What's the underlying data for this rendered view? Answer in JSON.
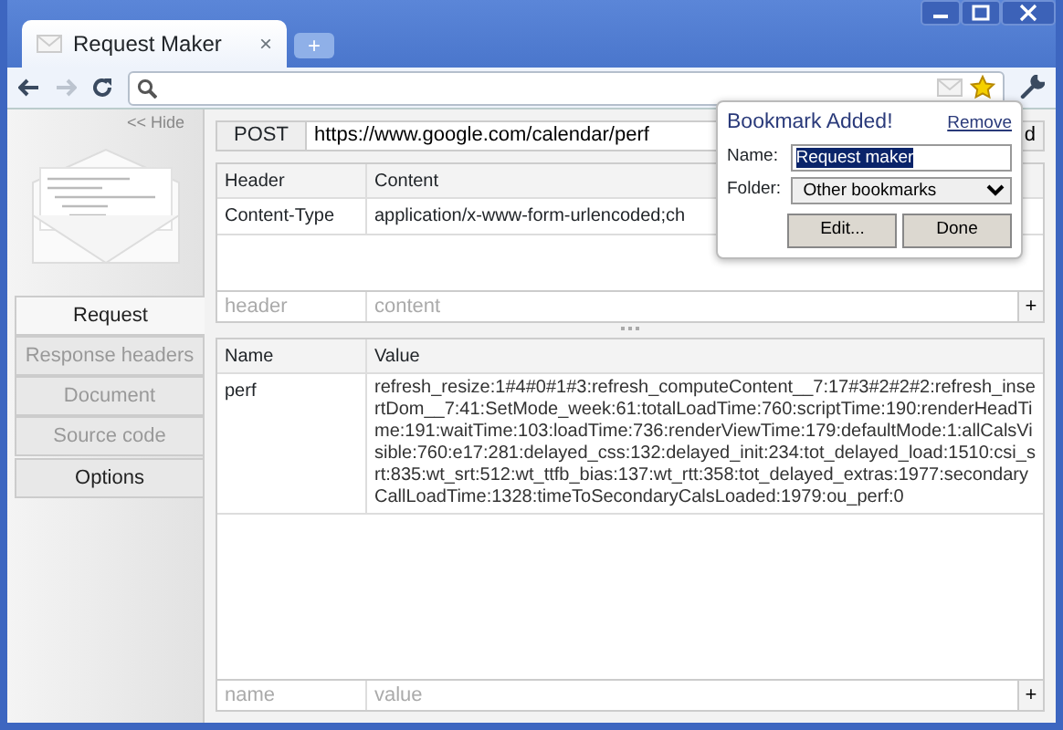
{
  "browser": {
    "tab_title": "Request Maker",
    "close": "×",
    "new_tab": "+"
  },
  "sidebar": {
    "hide_link": "<< Hide",
    "tabs": [
      {
        "label": "Request",
        "selected": true,
        "disabled": false
      },
      {
        "label": "Response headers",
        "selected": false,
        "disabled": true
      },
      {
        "label": "Document",
        "selected": false,
        "disabled": true
      },
      {
        "label": "Source code",
        "selected": false,
        "disabled": true
      },
      {
        "label": "Options",
        "selected": false,
        "disabled": false
      }
    ]
  },
  "request": {
    "method": "POST",
    "url": "https://www.google.com/calendar/perf",
    "send_button": "d"
  },
  "headers_table": {
    "columns": [
      "Header",
      "Content"
    ],
    "rows": [
      {
        "header": "Content-Type",
        "content": "application/x-www-form-urlencoded;ch"
      }
    ],
    "new_row": {
      "header_placeholder": "header",
      "content_placeholder": "content",
      "add": "+"
    }
  },
  "params_table": {
    "columns": [
      "Name",
      "Value"
    ],
    "rows": [
      {
        "name": "perf",
        "value": "refresh_resize:1#4#0#1#3:refresh_computeContent__7:17#3#2#2#2:refresh_insertDom__7:41:SetMode_week:61:totalLoadTime:760:scriptTime:190:renderHeadTime:191:waitTime:103:loadTime:736:renderViewTime:179:defaultMode:1:allCalsVisible:760:e17:281:delayed_css:132:delayed_init:234:tot_delayed_load:1510:csi_srt:835:wt_srt:512:wt_ttfb_bias:137:wt_rtt:358:tot_delayed_extras:1977:secondaryCallLoadTime:1328:timeToSecondaryCalsLoaded:1979:ou_perf:0"
      }
    ],
    "new_row": {
      "name_placeholder": "name",
      "value_placeholder": "value",
      "add": "+"
    }
  },
  "bookmark_bubble": {
    "title": "Bookmark Added!",
    "remove": "Remove",
    "name_label": "Name:",
    "name_value": "Request maker",
    "folder_label": "Folder:",
    "folder_value": "Other bookmarks",
    "buttons": [
      "Edit...",
      "Done"
    ]
  }
}
